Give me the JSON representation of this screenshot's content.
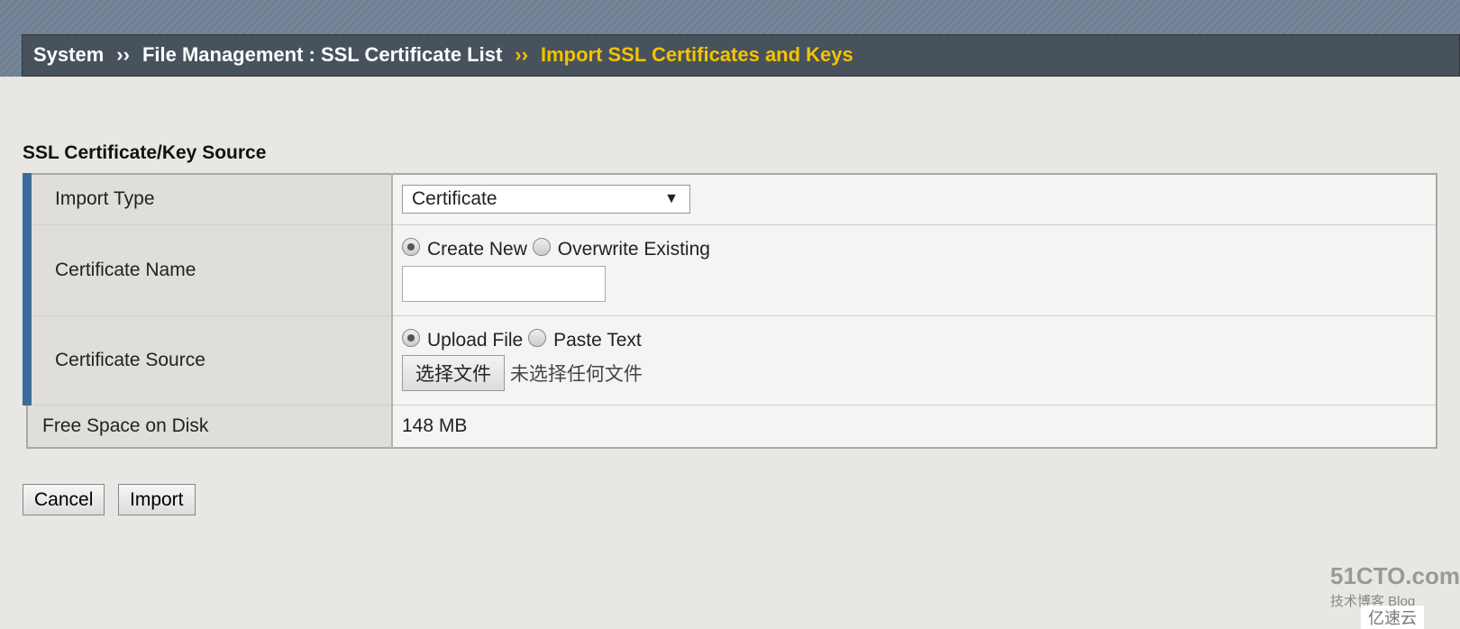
{
  "breadcrumb": {
    "items": [
      "System",
      "File Management : SSL Certificate List"
    ],
    "separator": "››",
    "current": "Import SSL Certificates and Keys"
  },
  "section_title": "SSL Certificate/Key Source",
  "form": {
    "import_type": {
      "label": "Import Type",
      "value": "Certificate"
    },
    "certificate_name": {
      "label": "Certificate Name",
      "options": [
        "Create New",
        "Overwrite Existing"
      ],
      "selected": "Create New",
      "value": ""
    },
    "certificate_source": {
      "label": "Certificate Source",
      "options": [
        "Upload File",
        "Paste Text"
      ],
      "selected": "Upload File",
      "file_button": "选择文件",
      "file_status": "未选择任何文件"
    },
    "free_space": {
      "label": "Free Space on Disk",
      "value": "148 MB"
    }
  },
  "buttons": {
    "cancel": "Cancel",
    "import": "Import"
  },
  "watermark": {
    "line1": "51CTO.com",
    "line2": "技术博客 Blog",
    "line3": "亿速云"
  },
  "colors": {
    "accent": "#f4c300",
    "row_marker": "#3b6c9c"
  }
}
